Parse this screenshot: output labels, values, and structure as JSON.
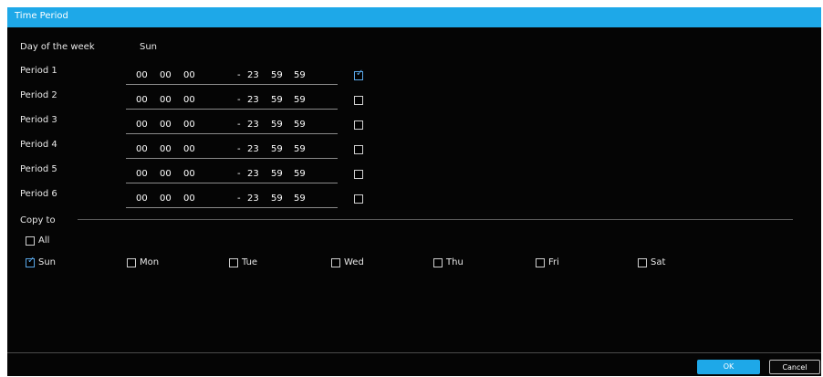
{
  "dialog": {
    "title": "Time Period"
  },
  "day_of_week": {
    "label": "Day of the week",
    "value": "Sun"
  },
  "periods": [
    {
      "label": "Period 1",
      "start_h": "00",
      "start_m": "00",
      "start_s": "00",
      "sep": "-",
      "end_h": "23",
      "end_m": "59",
      "end_s": "59",
      "checked": true
    },
    {
      "label": "Period 2",
      "start_h": "00",
      "start_m": "00",
      "start_s": "00",
      "sep": "-",
      "end_h": "23",
      "end_m": "59",
      "end_s": "59",
      "checked": false
    },
    {
      "label": "Period 3",
      "start_h": "00",
      "start_m": "00",
      "start_s": "00",
      "sep": "-",
      "end_h": "23",
      "end_m": "59",
      "end_s": "59",
      "checked": false
    },
    {
      "label": "Period 4",
      "start_h": "00",
      "start_m": "00",
      "start_s": "00",
      "sep": "-",
      "end_h": "23",
      "end_m": "59",
      "end_s": "59",
      "checked": false
    },
    {
      "label": "Period 5",
      "start_h": "00",
      "start_m": "00",
      "start_s": "00",
      "sep": "-",
      "end_h": "23",
      "end_m": "59",
      "end_s": "59",
      "checked": false
    },
    {
      "label": "Period 6",
      "start_h": "00",
      "start_m": "00",
      "start_s": "00",
      "sep": "-",
      "end_h": "23",
      "end_m": "59",
      "end_s": "59",
      "checked": false
    }
  ],
  "copy_to": {
    "label": "Copy to",
    "all_label": "All",
    "all_checked": false,
    "days": [
      {
        "label": "Sun",
        "checked": true
      },
      {
        "label": "Mon",
        "checked": false
      },
      {
        "label": "Tue",
        "checked": false
      },
      {
        "label": "Wed",
        "checked": false
      },
      {
        "label": "Thu",
        "checked": false
      },
      {
        "label": "Fri",
        "checked": false
      },
      {
        "label": "Sat",
        "checked": false
      }
    ]
  },
  "buttons": {
    "ok": "OK",
    "cancel": "Cancel"
  },
  "icons": {
    "checkbox_checked": "checkbox-checked-icon",
    "checkbox_unchecked": "checkbox-icon"
  },
  "colors": {
    "accent": "#1ea8e8",
    "background": "#050505",
    "text": "#ffffff"
  }
}
